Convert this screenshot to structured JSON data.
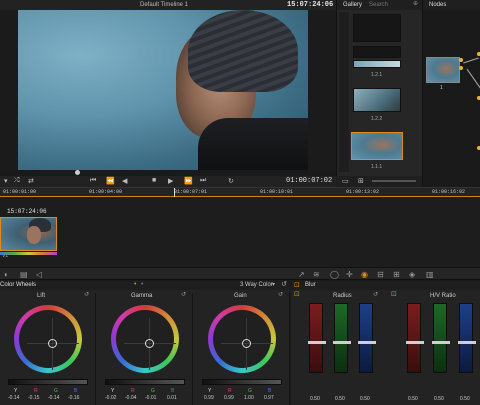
{
  "viewer": {
    "title": "Default Timeline 1",
    "timecode": "15:07:24:06",
    "playhead_timecode": "01:00:07:02",
    "transport": [
      "⏮",
      "⏪",
      "◀",
      "■",
      "▶",
      "⏩",
      "⏭",
      "↻"
    ]
  },
  "gallery": {
    "title": "Gallery",
    "search_placeholder": "Search",
    "stills": [
      {
        "label": "1.2.1"
      },
      {
        "label": "1.2.2"
      },
      {
        "label": "1.1.1"
      }
    ]
  },
  "nodes": {
    "title": "Nodes",
    "node_label": "1"
  },
  "timeline": {
    "ticks": [
      "01:00:01:00",
      "01:00:04:00",
      "01:00:07:01",
      "01:00:10:01",
      "01:00:13:02",
      "01:00:16:02"
    ],
    "clip_timecode": "15:07:24:06",
    "track_label": "V1"
  },
  "wheels": {
    "panel_title": "Color Wheels",
    "mode": "3 Way Color",
    "wheels": [
      {
        "name": "Lift",
        "labels": [
          "Y",
          "R",
          "G",
          "B"
        ],
        "values": [
          "-0.14",
          "-0.15",
          "-0.14",
          "-0.16"
        ]
      },
      {
        "name": "Gamma",
        "labels": [
          "Y",
          "R",
          "G",
          "B"
        ],
        "values": [
          "-0.02",
          "-0.04",
          "-0.01",
          "0.01"
        ]
      },
      {
        "name": "Gain",
        "labels": [
          "Y",
          "R",
          "G",
          "B"
        ],
        "values": [
          "0.99",
          "0.99",
          "1.00",
          "0.97"
        ]
      }
    ]
  },
  "blur": {
    "panel_title": "Blur",
    "radius_label": "Radius",
    "ratio_label": "H/V Ratio",
    "radius_values": [
      "0.50",
      "0.50",
      "0.50"
    ],
    "ratio_values": [
      "0.50",
      "0.50",
      "0.50"
    ]
  },
  "colors": {
    "accent": "#e08a1d",
    "background": "#1b1b1b"
  }
}
